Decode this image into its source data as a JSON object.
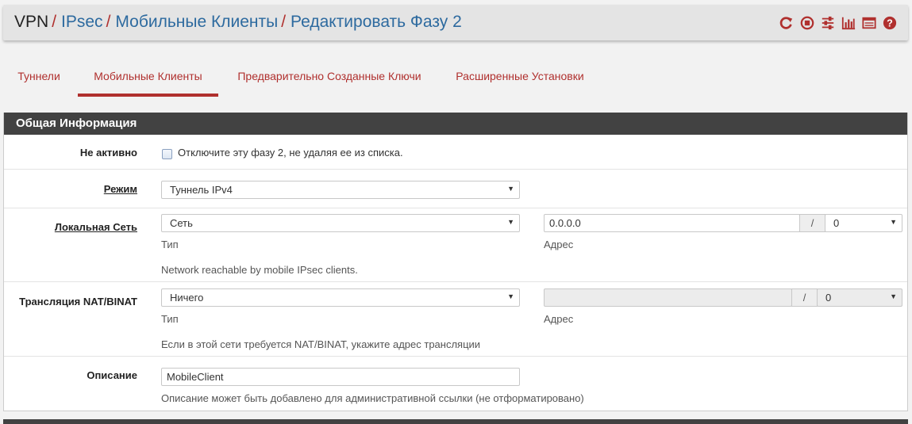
{
  "breadcrumb": [
    {
      "label": "VPN",
      "link": false
    },
    {
      "label": "IPsec",
      "link": true
    },
    {
      "label": "Мобильные Клиенты",
      "link": true
    },
    {
      "label": "Редактировать Фазу 2",
      "link": true
    }
  ],
  "breadcrumb_separator": "/",
  "header_icons": [
    "restart-service-icon",
    "stop-service-icon",
    "settings-sliders-icon",
    "status-chart-icon",
    "log-icon",
    "help-icon"
  ],
  "accent_color": "#b0302e",
  "link_color": "#2d6a9f",
  "tabs": [
    {
      "label": "Туннели",
      "active": false
    },
    {
      "label": "Мобильные Клиенты",
      "active": true
    },
    {
      "label": "Предварительно Созданные Ключи",
      "active": false
    },
    {
      "label": "Расширенные Установки",
      "active": false
    }
  ],
  "panel": {
    "title": "Общая Информация",
    "disabled": {
      "label": "Не активно",
      "checked": false,
      "text": "Отключите эту фазу 2, не удаляя ее из списка."
    },
    "mode": {
      "label": "Режим",
      "value": "Туннель IPv4"
    },
    "local_network": {
      "label": "Локальная Сеть",
      "type_value": "Сеть",
      "type_hint": "Тип",
      "address_value": "0.0.0.0",
      "address_hint": "Адрес",
      "slash": "/",
      "mask_value": "0",
      "help": "Network reachable by mobile IPsec clients."
    },
    "nat": {
      "label": "Трансляция NAT/BINAT",
      "type_value": "Ничего",
      "type_hint": "Тип",
      "address_value": "",
      "address_hint": "Адрес",
      "slash": "/",
      "mask_value": "0",
      "help": "Если в этой сети требуется NAT/BINAT, укажите адрес трансляции"
    },
    "description": {
      "label": "Описание",
      "value": "MobileClient",
      "help": "Описание может быть добавлено для административной ссылки (не отформатировано)"
    }
  }
}
